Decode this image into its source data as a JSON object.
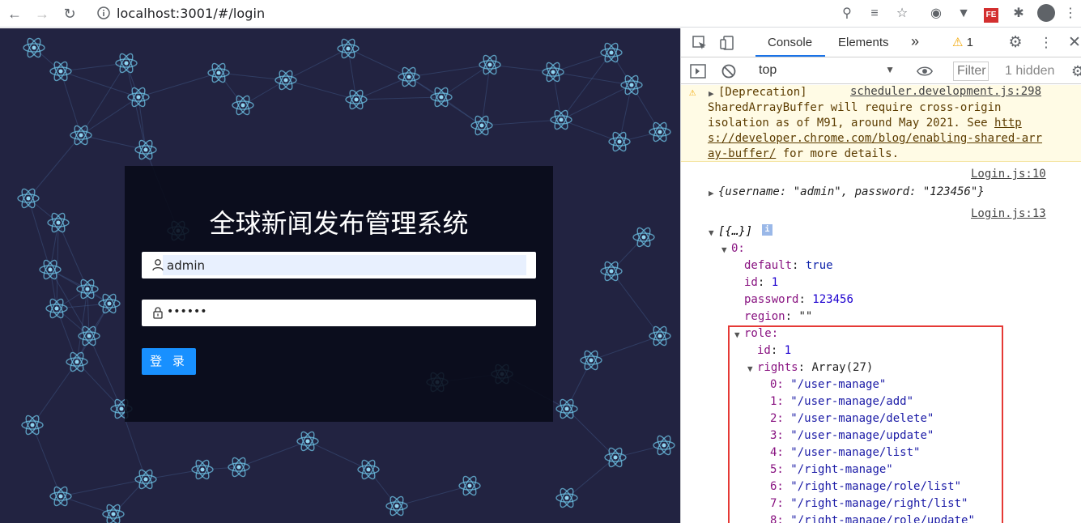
{
  "browser": {
    "url": "localhost:3001/#/login"
  },
  "login": {
    "title": "全球新闻发布管理系统",
    "username_value": "admin",
    "password_value": "••••••",
    "login_label": "登 录"
  },
  "devtools": {
    "tabs": [
      "Console",
      "Elements"
    ],
    "more_tabs": "»",
    "warning_count": "1",
    "context": "top",
    "filter_placeholder": "Filter",
    "hidden_count": "1 hidden",
    "messages": {
      "warning": {
        "prefix": "[Deprecation]",
        "source": "scheduler.development.js:298",
        "lines": [
          "SharedArrayBuffer will require cross-origin",
          "isolation as of M91, around May 2021. See ",
          "s://developer.chrome.com/blog/enabling-shared-arr",
          "ay-buffer/"
        ],
        "link_start": "http",
        "suffix": " for more details."
      },
      "log1": {
        "source": "Login.js:10",
        "text": "{username: \"admin\", password: \"123456\"}"
      },
      "log2": {
        "source": "Login.js:13",
        "summary": "[{…}]",
        "index0": "0:",
        "props": [
          {
            "key": "default",
            "value": "true"
          },
          {
            "key": "id",
            "value": "1"
          },
          {
            "key": "password",
            "value": "123456"
          },
          {
            "key": "region",
            "value": "\"\""
          }
        ],
        "role_key": "role:",
        "role_id_key": "id",
        "role_id_value": "1",
        "rights_key": "rights",
        "rights_value": "Array(27)",
        "rights": [
          "\"/user-manage\"",
          "\"/user-manage/add\"",
          "\"/user-manage/delete\"",
          "\"/user-manage/update\"",
          "\"/user-manage/list\"",
          "\"/right-manage\"",
          "\"/right-manage/role/list\"",
          "\"/right-manage/right/list\"",
          "\"/right-manage/role/update\""
        ]
      }
    }
  }
}
